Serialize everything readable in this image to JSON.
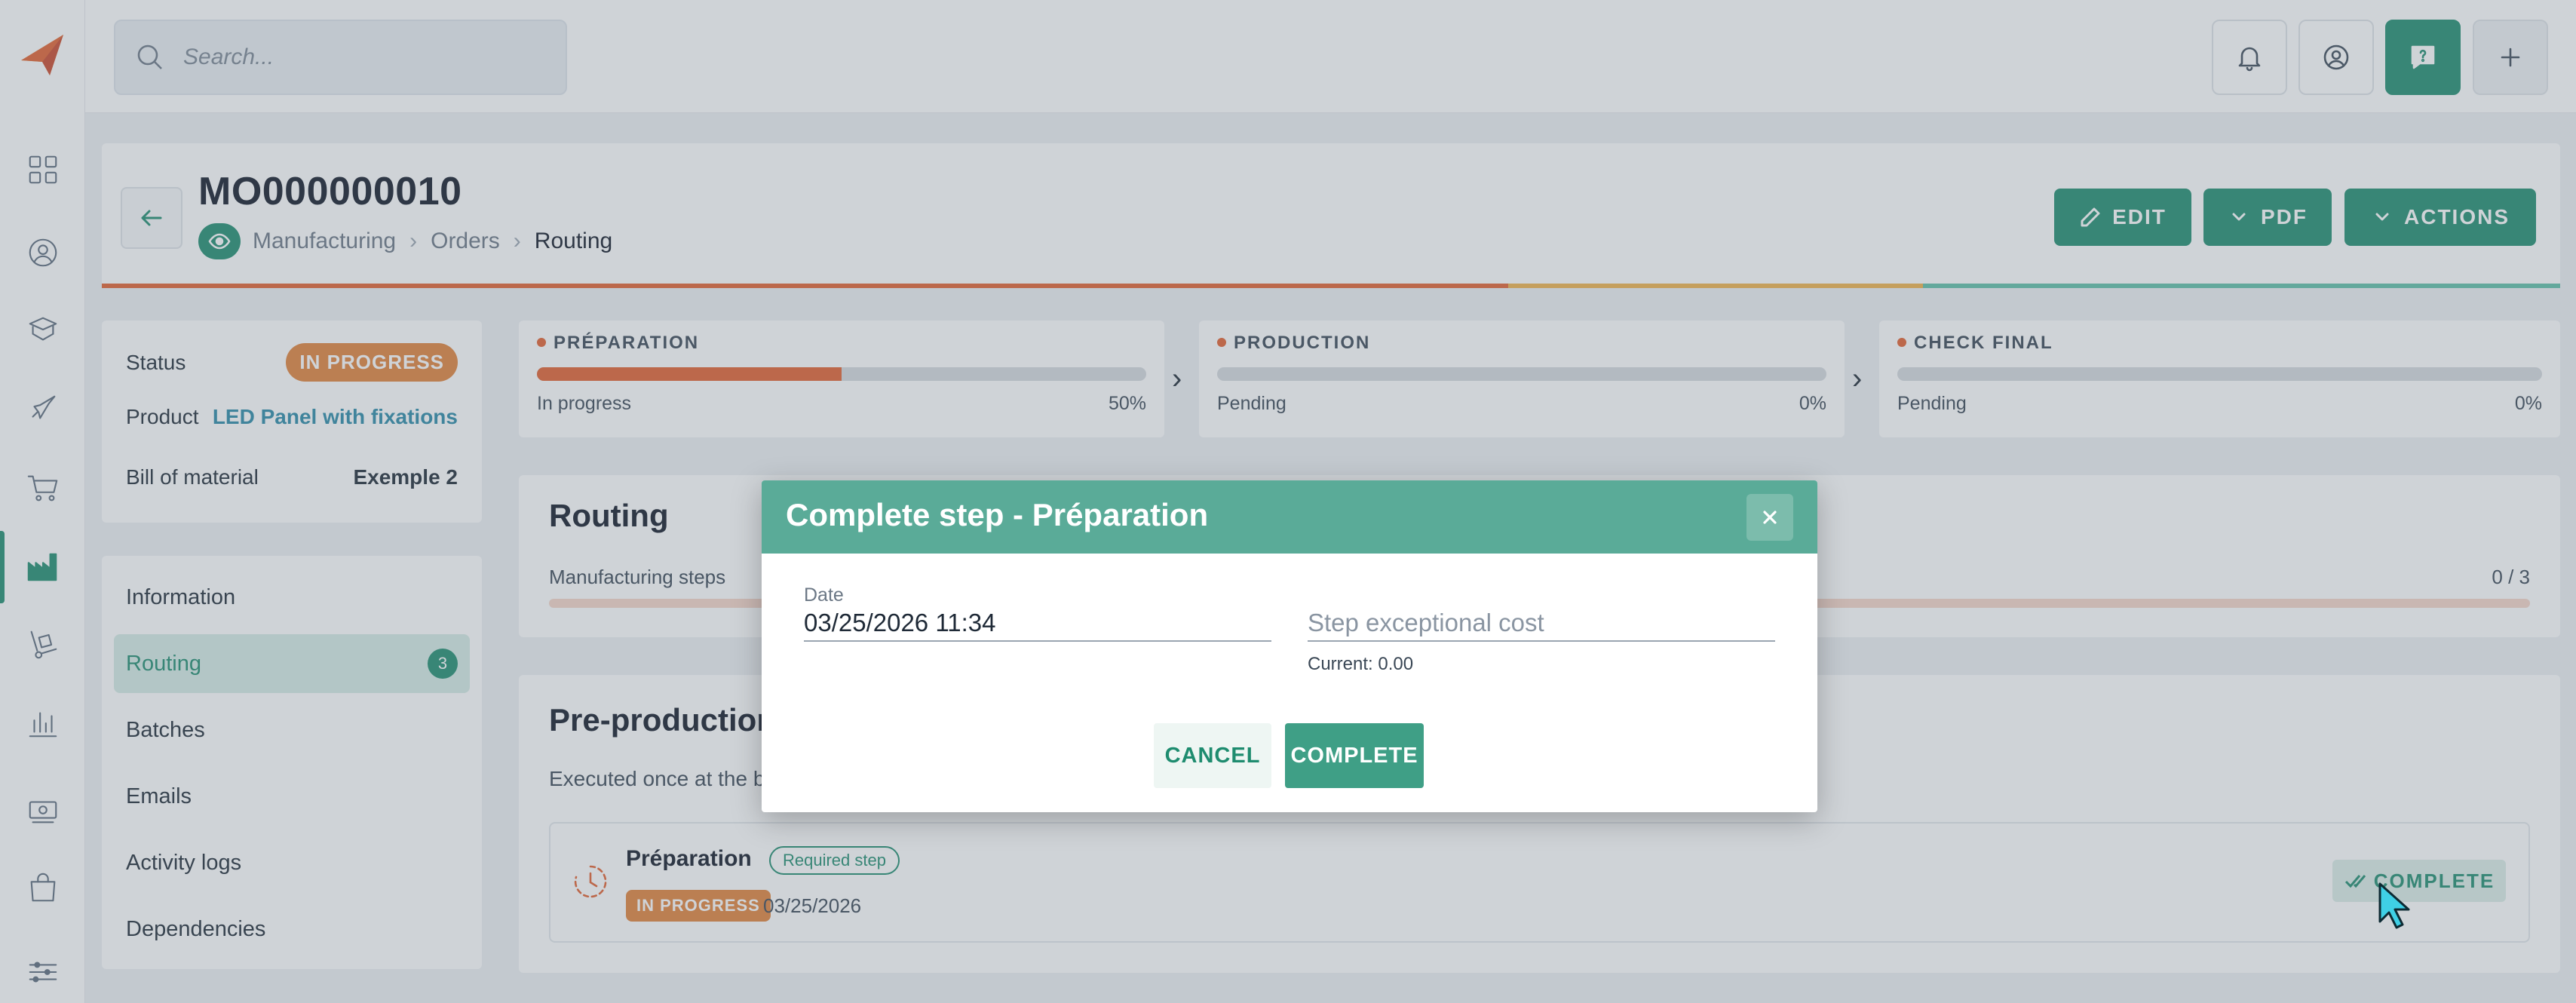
{
  "search": {
    "placeholder": "Search..."
  },
  "record": {
    "title": "MO000000010",
    "breadcrumb": [
      "Manufacturing",
      "Orders",
      "Routing"
    ],
    "breadcrumb_sep": "›"
  },
  "header_actions": {
    "edit": "EDIT",
    "pdf": "PDF",
    "actions": "ACTIONS"
  },
  "info": {
    "status_label": "Status",
    "status_value": "IN PROGRESS",
    "product_label": "Product",
    "product_value": "LED Panel with fixations",
    "bom_label": "Bill of material",
    "bom_value": "Exemple 2"
  },
  "menu": {
    "items": [
      {
        "label": "Information"
      },
      {
        "label": "Routing",
        "count": "3"
      },
      {
        "label": "Batches"
      },
      {
        "label": "Emails"
      },
      {
        "label": "Activity logs"
      },
      {
        "label": "Dependencies"
      }
    ]
  },
  "steps": [
    {
      "name": "PRÉPARATION",
      "state": "In progress",
      "percent_label": "50%",
      "progress": 0.5
    },
    {
      "name": "PRODUCTION",
      "state": "Pending",
      "percent_label": "0%",
      "progress": 0
    },
    {
      "name": "CHECK FINAL",
      "state": "Pending",
      "percent_label": "0%",
      "progress": 0
    }
  ],
  "step_chevron": "›",
  "routing": {
    "title": "Routing",
    "sub": "Manufacturing steps",
    "ratio": "0 / 3"
  },
  "preproduction": {
    "title": "Pre-production",
    "sub": "Executed once at the beginning",
    "step": {
      "name": "Préparation",
      "required": "Required step",
      "status": "IN PROGRESS",
      "date": "03/25/2026",
      "complete_label": "COMPLETE"
    }
  },
  "modal": {
    "title": "Complete step - Préparation",
    "date_label": "Date",
    "date_value": "03/25/2026 11:34",
    "cost_placeholder": "Step exceptional cost",
    "cost_hint": "Current: 0.00",
    "cancel": "CANCEL",
    "complete": "COMPLETE"
  },
  "colors": {
    "accent": "#1e8c6f",
    "progress": "#e3602f",
    "status_badge": "#e2823a",
    "strip": [
      "#e3602f",
      "#e3602f",
      "#f0b24a",
      "#5fbfa8"
    ]
  },
  "icons": {
    "rail": [
      "dashboard-icon",
      "contacts-icon",
      "products-icon",
      "marketing-icon",
      "sales-icon",
      "manufacturing-icon",
      "logistics-icon",
      "reports-icon",
      "finance-icon",
      "shop-icon",
      "settings-icon"
    ],
    "top": [
      "bell-icon",
      "account-icon",
      "help-icon",
      "plus-icon"
    ]
  }
}
